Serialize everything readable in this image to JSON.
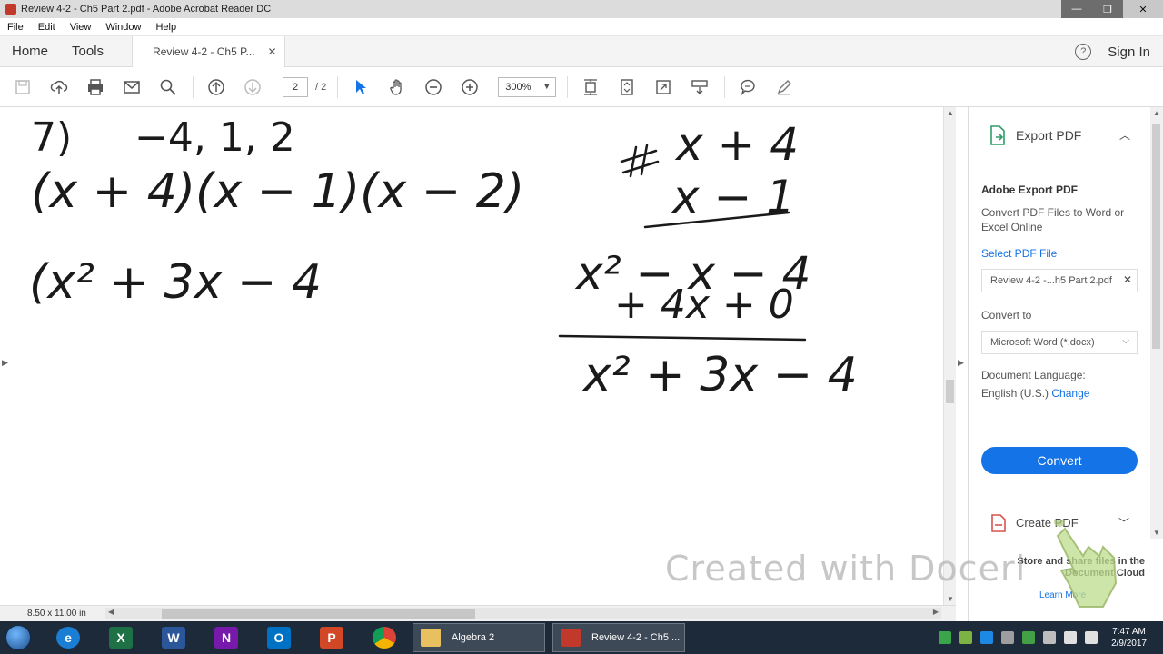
{
  "window": {
    "title": "Review 4-2 - Ch5 Part 2.pdf - Adobe Acrobat Reader DC",
    "minimize": "—",
    "maximize": "❐",
    "close": "✕"
  },
  "menu": [
    "File",
    "Edit",
    "View",
    "Window",
    "Help"
  ],
  "tabs": {
    "home": "Home",
    "tools": "Tools",
    "document": "Review 4-2 - Ch5 P...",
    "close": "✕"
  },
  "header": {
    "help": "?",
    "signin": "Sign In"
  },
  "toolbar": {
    "page_current": "2",
    "page_total": "/ 2",
    "zoom": "300%"
  },
  "document": {
    "problem_number": "7)",
    "roots": "−4, 1, 2",
    "factors": "(x + 4)(x − 1)(x − 2)",
    "partial": "(x² + 3x − 4",
    "mult_top": "x + 4",
    "mult_bottom": "x − 1",
    "row1": "x² − x − 4",
    "row2": "+ 4x + 0",
    "result": "x² + 3x − 4"
  },
  "status": {
    "page_size": "8.50 x 11.00 in"
  },
  "right_panel": {
    "export_title": "Export PDF",
    "heading": "Adobe Export PDF",
    "description": "Convert PDF Files to Word or Excel Online",
    "select_file": "Select PDF File",
    "file_name": "Review 4-2 -...h5 Part 2.pdf",
    "convert_to_label": "Convert to",
    "convert_to_value": "Microsoft Word (*.docx)",
    "language_label": "Document Language:",
    "language_value": "English (U.S.)",
    "change": "Change",
    "convert_button": "Convert",
    "create_title": "Create PDF",
    "cloud_text": "Store and share files in the Document Cloud",
    "learn_more": "Learn More"
  },
  "watermark": "Created with Doceri",
  "taskbar": {
    "folder_task": "Algebra 2",
    "acrobat_task": "Review 4-2 - Ch5 ...",
    "time": "7:47 AM",
    "date": "2/9/2017"
  },
  "colors": {
    "accent": "#1473e6",
    "ink": "#1a1a1a",
    "taskbar": "#1c2a3a"
  }
}
